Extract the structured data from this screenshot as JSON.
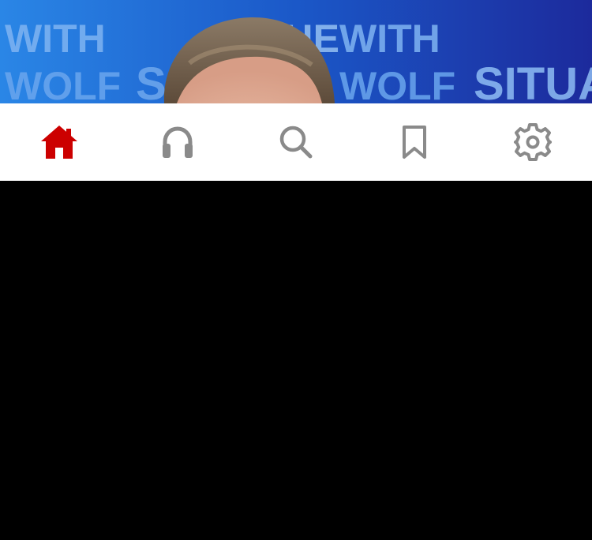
{
  "hero": {
    "background_words": [
      "WITH",
      "WOLF",
      "THE",
      "WITH",
      "WOLF",
      "SITUAT"
    ],
    "image_subject": "news anchor photo"
  },
  "tabbar": {
    "active_color": "#cc0000",
    "inactive_color": "#8a8a8a",
    "background": "#ffffff",
    "tabs": [
      {
        "icon": "home-icon",
        "active": true
      },
      {
        "icon": "headphones-icon",
        "active": false
      },
      {
        "icon": "search-icon",
        "active": false
      },
      {
        "icon": "bookmark-icon",
        "active": false
      },
      {
        "icon": "gear-icon",
        "active": false
      }
    ]
  }
}
